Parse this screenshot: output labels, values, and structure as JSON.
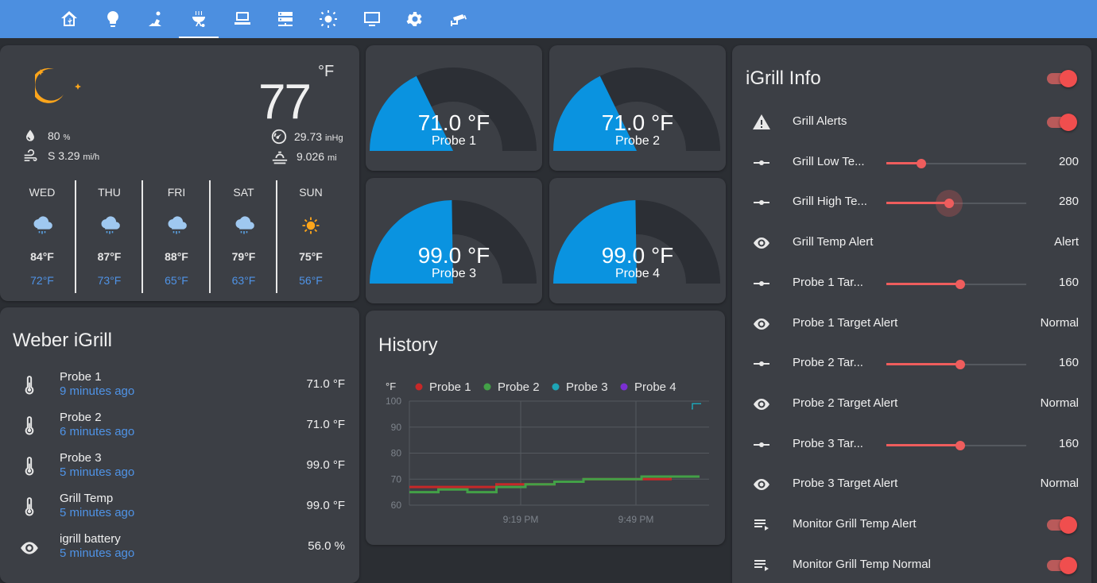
{
  "nav": {
    "tabs": [
      {
        "icon": "home-assistant-icon"
      },
      {
        "icon": "lightbulb-icon"
      },
      {
        "icon": "vacuum-icon"
      },
      {
        "icon": "grill-icon",
        "active": true
      },
      {
        "icon": "laptop-icon"
      },
      {
        "icon": "server-icon"
      },
      {
        "icon": "brightness-icon"
      },
      {
        "icon": "monitor-icon"
      },
      {
        "icon": "gear-icon"
      },
      {
        "icon": "cctv-icon"
      }
    ]
  },
  "weather": {
    "unit": "°F",
    "temperature": "77",
    "humidity": "80",
    "humidity_unit": "%",
    "wind": "S 3.29",
    "wind_unit": "mi/h",
    "pressure": "29.73",
    "pressure_unit": "inHg",
    "visibility": "9.026",
    "visibility_unit": "mi",
    "forecast": [
      {
        "day": "WED",
        "high": "84°F",
        "low": "72°F",
        "icon": "rainy-cloud-icon"
      },
      {
        "day": "THU",
        "high": "87°F",
        "low": "73°F",
        "icon": "rainy-cloud-icon"
      },
      {
        "day": "FRI",
        "high": "88°F",
        "low": "65°F",
        "icon": "rainy-cloud-icon"
      },
      {
        "day": "SAT",
        "high": "79°F",
        "low": "63°F",
        "icon": "rainy-cloud-icon"
      },
      {
        "day": "SUN",
        "high": "75°F",
        "low": "56°F",
        "icon": "sun-icon"
      }
    ]
  },
  "gauges": [
    {
      "value": "71.0 °F",
      "label": "Probe 1",
      "level": 0.355
    },
    {
      "value": "71.0 °F",
      "label": "Probe 2",
      "level": 0.355
    },
    {
      "value": "99.0 °F",
      "label": "Probe 3",
      "level": 0.495
    },
    {
      "value": "99.0 °F",
      "label": "Probe 4",
      "level": 0.495
    }
  ],
  "igrill": {
    "title": "Weber iGrill",
    "rows": [
      {
        "name": "Probe 1",
        "time": "9 minutes ago",
        "value": "71.0 °F",
        "icon": "thermometer-icon"
      },
      {
        "name": "Probe 2",
        "time": "6 minutes ago",
        "value": "71.0 °F",
        "icon": "thermometer-icon"
      },
      {
        "name": "Probe 3",
        "time": "5 minutes ago",
        "value": "99.0 °F",
        "icon": "thermometer-icon"
      },
      {
        "name": "Grill Temp",
        "time": "5 minutes ago",
        "value": "99.0 °F",
        "icon": "thermometer-icon"
      },
      {
        "name": "igrill battery",
        "time": "5 minutes ago",
        "value": "56.0 %",
        "icon": "eye-icon"
      }
    ]
  },
  "history": {
    "title": "History",
    "unit": "°F",
    "colors": {
      "Probe 1": "#c62828",
      "Probe 2": "#43a047",
      "Probe 3": "#1ea5b6",
      "Probe 4": "#7b2fd1"
    }
  },
  "chart_data": {
    "type": "line",
    "title": "History",
    "ylabel": "°F",
    "xlabel": "",
    "ylim": [
      60,
      100
    ],
    "yticks": [
      "100",
      "90",
      "80",
      "70",
      "60"
    ],
    "xticks": [
      "9:19 PM",
      "9:49 PM"
    ],
    "grid": true,
    "legend_position": "top",
    "series": [
      {
        "name": "Probe 1",
        "values": [
          67,
          67,
          67,
          68,
          68,
          69,
          70,
          70,
          70,
          71,
          71
        ]
      },
      {
        "name": "Probe 2",
        "values": [
          65,
          66,
          65,
          67,
          68,
          69,
          70,
          70,
          71,
          71,
          71
        ]
      },
      {
        "name": "Probe 3",
        "values": [
          97,
          99,
          99
        ]
      },
      {
        "name": "Probe 4",
        "values": []
      }
    ]
  },
  "info": {
    "title": "iGrill Info",
    "rows": [
      {
        "name": "Grill Alerts",
        "icon": "alert-icon",
        "type": "toggle"
      },
      {
        "name": "Grill Low Te...",
        "icon": "slider-icon",
        "type": "slider",
        "value": "200",
        "level": 0.25
      },
      {
        "name": "Grill High Te...",
        "icon": "slider-icon",
        "type": "slider",
        "value": "280",
        "level": 0.45,
        "active": true
      },
      {
        "name": "Grill Temp Alert",
        "icon": "eye-icon",
        "type": "text",
        "value": "Alert"
      },
      {
        "name": "Probe 1 Tar...",
        "icon": "slider-icon",
        "type": "slider",
        "value": "160",
        "level": 0.53
      },
      {
        "name": "Probe 1 Target Alert",
        "icon": "eye-icon",
        "type": "text",
        "value": "Normal"
      },
      {
        "name": "Probe 2 Tar...",
        "icon": "slider-icon",
        "type": "slider",
        "value": "160",
        "level": 0.53
      },
      {
        "name": "Probe 2 Target Alert",
        "icon": "eye-icon",
        "type": "text",
        "value": "Normal"
      },
      {
        "name": "Probe 3 Tar...",
        "icon": "slider-icon",
        "type": "slider",
        "value": "160",
        "level": 0.53
      },
      {
        "name": "Probe 3 Target Alert",
        "icon": "eye-icon",
        "type": "text",
        "value": "Normal"
      },
      {
        "name": "Monitor Grill Temp Alert",
        "icon": "playlist-icon",
        "type": "toggle"
      },
      {
        "name": "Monitor Grill Temp Normal",
        "icon": "playlist-icon",
        "type": "toggle"
      }
    ]
  }
}
